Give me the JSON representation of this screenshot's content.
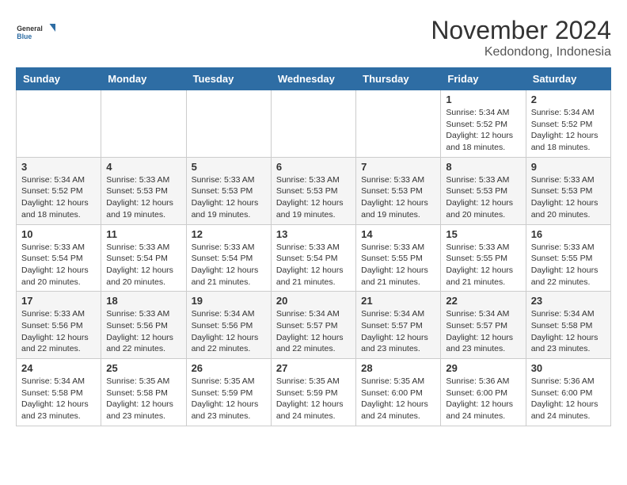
{
  "header": {
    "logo": {
      "line1": "General",
      "line2": "Blue"
    },
    "title": "November 2024",
    "subtitle": "Kedondong, Indonesia"
  },
  "weekdays": [
    "Sunday",
    "Monday",
    "Tuesday",
    "Wednesday",
    "Thursday",
    "Friday",
    "Saturday"
  ],
  "weeks": [
    [
      {
        "day": "",
        "info": ""
      },
      {
        "day": "",
        "info": ""
      },
      {
        "day": "",
        "info": ""
      },
      {
        "day": "",
        "info": ""
      },
      {
        "day": "",
        "info": ""
      },
      {
        "day": "1",
        "info": "Sunrise: 5:34 AM\nSunset: 5:52 PM\nDaylight: 12 hours and 18 minutes."
      },
      {
        "day": "2",
        "info": "Sunrise: 5:34 AM\nSunset: 5:52 PM\nDaylight: 12 hours and 18 minutes."
      }
    ],
    [
      {
        "day": "3",
        "info": "Sunrise: 5:34 AM\nSunset: 5:52 PM\nDaylight: 12 hours and 18 minutes."
      },
      {
        "day": "4",
        "info": "Sunrise: 5:33 AM\nSunset: 5:53 PM\nDaylight: 12 hours and 19 minutes."
      },
      {
        "day": "5",
        "info": "Sunrise: 5:33 AM\nSunset: 5:53 PM\nDaylight: 12 hours and 19 minutes."
      },
      {
        "day": "6",
        "info": "Sunrise: 5:33 AM\nSunset: 5:53 PM\nDaylight: 12 hours and 19 minutes."
      },
      {
        "day": "7",
        "info": "Sunrise: 5:33 AM\nSunset: 5:53 PM\nDaylight: 12 hours and 19 minutes."
      },
      {
        "day": "8",
        "info": "Sunrise: 5:33 AM\nSunset: 5:53 PM\nDaylight: 12 hours and 20 minutes."
      },
      {
        "day": "9",
        "info": "Sunrise: 5:33 AM\nSunset: 5:53 PM\nDaylight: 12 hours and 20 minutes."
      }
    ],
    [
      {
        "day": "10",
        "info": "Sunrise: 5:33 AM\nSunset: 5:54 PM\nDaylight: 12 hours and 20 minutes."
      },
      {
        "day": "11",
        "info": "Sunrise: 5:33 AM\nSunset: 5:54 PM\nDaylight: 12 hours and 20 minutes."
      },
      {
        "day": "12",
        "info": "Sunrise: 5:33 AM\nSunset: 5:54 PM\nDaylight: 12 hours and 21 minutes."
      },
      {
        "day": "13",
        "info": "Sunrise: 5:33 AM\nSunset: 5:54 PM\nDaylight: 12 hours and 21 minutes."
      },
      {
        "day": "14",
        "info": "Sunrise: 5:33 AM\nSunset: 5:55 PM\nDaylight: 12 hours and 21 minutes."
      },
      {
        "day": "15",
        "info": "Sunrise: 5:33 AM\nSunset: 5:55 PM\nDaylight: 12 hours and 21 minutes."
      },
      {
        "day": "16",
        "info": "Sunrise: 5:33 AM\nSunset: 5:55 PM\nDaylight: 12 hours and 22 minutes."
      }
    ],
    [
      {
        "day": "17",
        "info": "Sunrise: 5:33 AM\nSunset: 5:56 PM\nDaylight: 12 hours and 22 minutes."
      },
      {
        "day": "18",
        "info": "Sunrise: 5:33 AM\nSunset: 5:56 PM\nDaylight: 12 hours and 22 minutes."
      },
      {
        "day": "19",
        "info": "Sunrise: 5:34 AM\nSunset: 5:56 PM\nDaylight: 12 hours and 22 minutes."
      },
      {
        "day": "20",
        "info": "Sunrise: 5:34 AM\nSunset: 5:57 PM\nDaylight: 12 hours and 22 minutes."
      },
      {
        "day": "21",
        "info": "Sunrise: 5:34 AM\nSunset: 5:57 PM\nDaylight: 12 hours and 23 minutes."
      },
      {
        "day": "22",
        "info": "Sunrise: 5:34 AM\nSunset: 5:57 PM\nDaylight: 12 hours and 23 minutes."
      },
      {
        "day": "23",
        "info": "Sunrise: 5:34 AM\nSunset: 5:58 PM\nDaylight: 12 hours and 23 minutes."
      }
    ],
    [
      {
        "day": "24",
        "info": "Sunrise: 5:34 AM\nSunset: 5:58 PM\nDaylight: 12 hours and 23 minutes."
      },
      {
        "day": "25",
        "info": "Sunrise: 5:35 AM\nSunset: 5:58 PM\nDaylight: 12 hours and 23 minutes."
      },
      {
        "day": "26",
        "info": "Sunrise: 5:35 AM\nSunset: 5:59 PM\nDaylight: 12 hours and 23 minutes."
      },
      {
        "day": "27",
        "info": "Sunrise: 5:35 AM\nSunset: 5:59 PM\nDaylight: 12 hours and 24 minutes."
      },
      {
        "day": "28",
        "info": "Sunrise: 5:35 AM\nSunset: 6:00 PM\nDaylight: 12 hours and 24 minutes."
      },
      {
        "day": "29",
        "info": "Sunrise: 5:36 AM\nSunset: 6:00 PM\nDaylight: 12 hours and 24 minutes."
      },
      {
        "day": "30",
        "info": "Sunrise: 5:36 AM\nSunset: 6:00 PM\nDaylight: 12 hours and 24 minutes."
      }
    ]
  ]
}
